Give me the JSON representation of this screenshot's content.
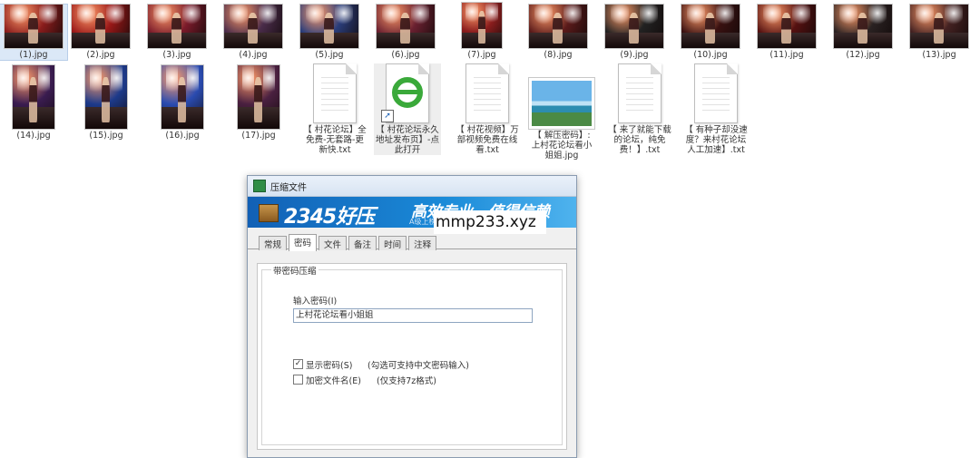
{
  "files": [
    {
      "name": "(1).jpg",
      "kind": "image"
    },
    {
      "name": "(2).jpg",
      "kind": "image"
    },
    {
      "name": "(3).jpg",
      "kind": "image"
    },
    {
      "name": "(4).jpg",
      "kind": "image"
    },
    {
      "name": "(5).jpg",
      "kind": "image"
    },
    {
      "name": "(6).jpg",
      "kind": "image"
    },
    {
      "name": "(7).jpg",
      "kind": "image"
    },
    {
      "name": "(8).jpg",
      "kind": "image"
    },
    {
      "name": "(9).jpg",
      "kind": "image"
    },
    {
      "name": "(10).jpg",
      "kind": "image"
    },
    {
      "name": "(11).jpg",
      "kind": "image"
    },
    {
      "name": "(12).jpg",
      "kind": "image"
    },
    {
      "name": "(13).jpg",
      "kind": "image"
    },
    {
      "name": "(14).jpg",
      "kind": "image"
    },
    {
      "name": "(15).jpg",
      "kind": "image"
    },
    {
      "name": "(16).jpg",
      "kind": "image"
    },
    {
      "name": "(17).jpg",
      "kind": "image"
    },
    {
      "name": "【 村花论坛】全\n免费-无套路-更\n新快.txt",
      "kind": "text-file"
    },
    {
      "name": "【 村花论坛永久\n地址发布页】-点\n此打开",
      "kind": "ie-shortcut"
    },
    {
      "name": "【 村花视频】万\n部视频免费在线\n看.txt",
      "kind": "text-file"
    },
    {
      "name": "【 解压密码】:\n上村花论坛看小\n姐姐.jpg",
      "kind": "landscape-image"
    },
    {
      "name": "【 来了就能下载\n的论坛，纯免\n费！】.txt",
      "kind": "text-file"
    },
    {
      "name": "【 有种子却没速\n度？来村花论坛\n人工加速】.txt",
      "kind": "text-file"
    }
  ],
  "dialog": {
    "title": "压缩文件",
    "brand": "2345好压",
    "slogan": "高效专业，值得信赖",
    "slogan_small": "A级上榜",
    "tabs": [
      "常规",
      "密码",
      "文件",
      "备注",
      "时间",
      "注释"
    ],
    "active_tab": "密码",
    "group_title": "带密码压缩",
    "password_label": "输入密码(I)",
    "password_value": "上村花论坛看小姐姐",
    "show_password_label": "显示密码(S)",
    "show_password_hint": "(勾选可支持中文密码输入)",
    "show_password_checked": true,
    "encrypt_names_label": "加密文件名(E)",
    "encrypt_names_hint": "(仅支持7z格式)",
    "encrypt_names_checked": false
  },
  "watermark": "mmp233.xyz",
  "colors": {
    "banner_blue": "#1a7fd0",
    "ie_green": "#3aa93a",
    "selection": "#dbe8f7"
  }
}
